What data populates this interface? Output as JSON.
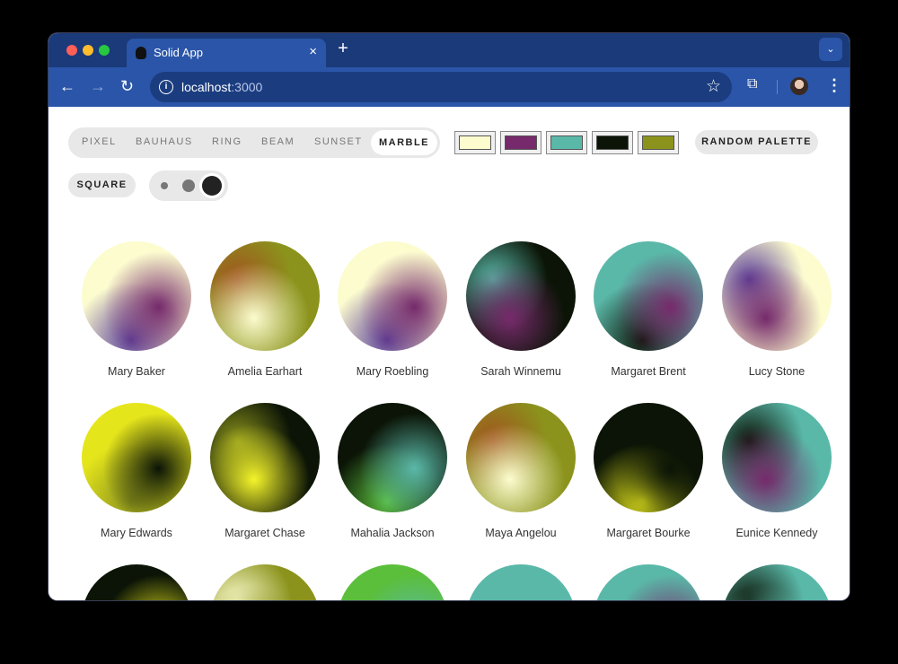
{
  "browser": {
    "tab_title": "Solid App",
    "tab_close": "×",
    "new_tab": "+",
    "tab_menu": "⌄",
    "url_host": "localhost",
    "url_port": ":3000",
    "icons": [
      "back-arrow-icon",
      "forward-arrow-icon",
      "reload-icon",
      "info-icon",
      "star-icon",
      "extensions-icon",
      "avatar",
      "kebab-menu-icon"
    ]
  },
  "variants": [
    "PIXEL",
    "BAUHAUS",
    "RING",
    "BEAM",
    "SUNSET",
    "MARBLE"
  ],
  "selected_variant": "MARBLE",
  "palette": [
    "#fcfccf",
    "#762a6b",
    "#5ab8a8",
    "#0b1406",
    "#8b931c"
  ],
  "random_palette_label": "RANDOM PALETTE",
  "square_label": "SQUARE",
  "size_selected": "large",
  "avatars": [
    {
      "name": "Mary Baker",
      "colors": [
        "#fcfccf",
        "#762a6b",
        "#5b3f98"
      ]
    },
    {
      "name": "Amelia Earhart",
      "colors": [
        "#8b931c",
        "#fcfccf",
        "#a0541f"
      ]
    },
    {
      "name": "Mary Roebling",
      "colors": [
        "#fcfccf",
        "#762a6b",
        "#5b3f98"
      ]
    },
    {
      "name": "Sarah Winnemu",
      "colors": [
        "#0b1406",
        "#762a6b",
        "#5ab8a8"
      ]
    },
    {
      "name": "Margaret Brent",
      "colors": [
        "#5ab8a8",
        "#762a6b",
        "#0b1406"
      ]
    },
    {
      "name": "Lucy Stone",
      "colors": [
        "#fcfccf",
        "#762a6b",
        "#5b3f98"
      ]
    },
    {
      "name": "Mary Edwards",
      "colors": [
        "#e5e51c",
        "#0b1406",
        "#8b931c"
      ]
    },
    {
      "name": "Margaret Chase",
      "colors": [
        "#0b1406",
        "#f4f42a",
        "#8b931c"
      ]
    },
    {
      "name": "Mahalia Jackson",
      "colors": [
        "#0b1406",
        "#5ab8a8",
        "#5bbf3c"
      ]
    },
    {
      "name": "Maya Angelou",
      "colors": [
        "#8b931c",
        "#fcfccf",
        "#a0541f"
      ]
    },
    {
      "name": "Margaret Bourke",
      "colors": [
        "#0b1406",
        "#0b1406",
        "#dfe11c"
      ]
    },
    {
      "name": "Eunice Kennedy",
      "colors": [
        "#5ab8a8",
        "#762a6b",
        "#0b1406"
      ]
    },
    {
      "name": "",
      "colors": [
        "#0b1406",
        "#e5e51c",
        "#8b931c"
      ]
    },
    {
      "name": "",
      "colors": [
        "#8b931c",
        "#8b931c",
        "#fcfccf"
      ]
    },
    {
      "name": "",
      "colors": [
        "#5bbf3c",
        "#5ab8a8",
        "#5ab8a8"
      ]
    },
    {
      "name": "",
      "colors": [
        "#5ab8a8",
        "#5ab8a8",
        "#5ab8a8"
      ]
    },
    {
      "name": "",
      "colors": [
        "#5ab8a8",
        "#762a6b",
        "#5ab8a8"
      ]
    },
    {
      "name": "",
      "colors": [
        "#5ab8a8",
        "#5ab8a8",
        "#0b1406"
      ]
    }
  ]
}
